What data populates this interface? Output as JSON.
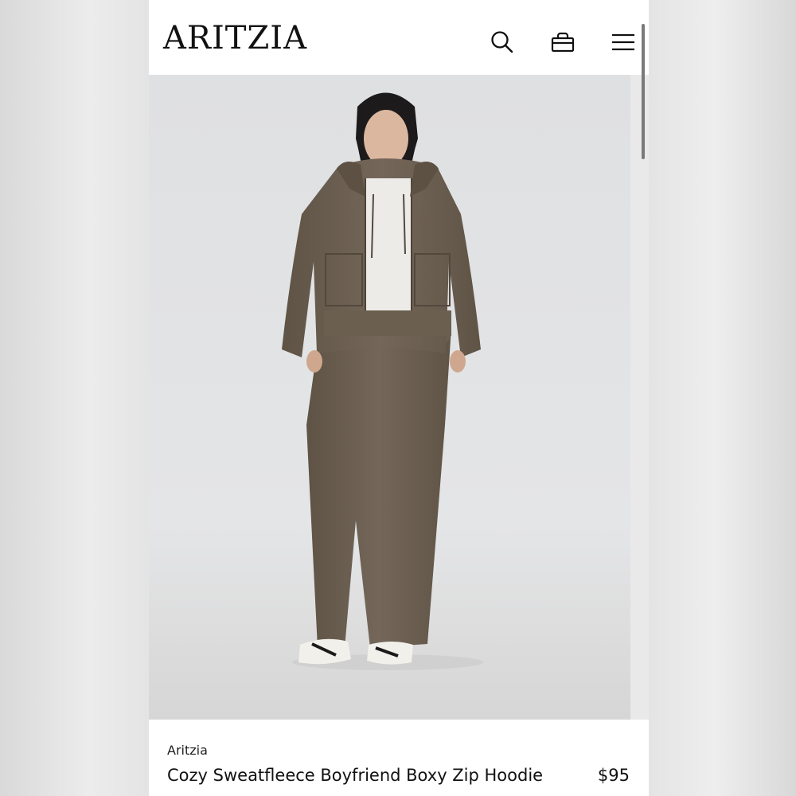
{
  "header": {
    "logo": "ARITZIA",
    "icons": [
      "search-icon",
      "bag-icon",
      "menu-icon"
    ]
  },
  "product": {
    "image_alt": "Model wearing brown zip hoodie and matching sweatpants",
    "brand": "Aritzia",
    "name": "Cozy Sweatfleece Boyfriend Boxy Zip Hoodie",
    "price": "$95"
  },
  "colors": {
    "garment": "#6e6150",
    "background": "#e3e4e6"
  }
}
